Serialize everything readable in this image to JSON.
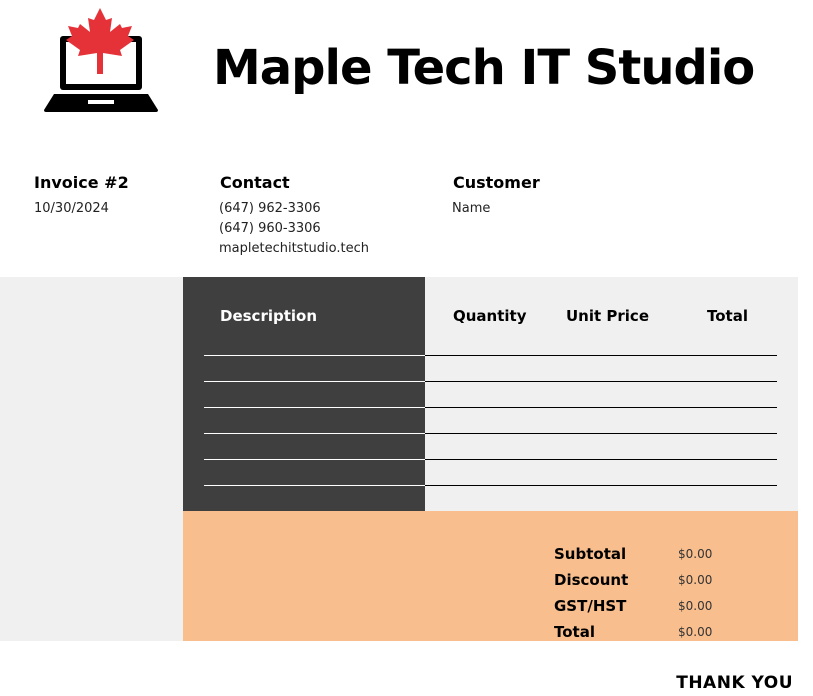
{
  "header": {
    "title": "Maple Tech IT Studio",
    "logo_icon": "laptop-maple-leaf-icon",
    "logo_colors": {
      "leaf": "#e53238",
      "laptop": "#000000"
    }
  },
  "invoice": {
    "label": "Invoice #2",
    "date": "10/30/2024"
  },
  "contact": {
    "label": "Contact",
    "phone1": "(647) 962-3306",
    "phone2": "(647) 960-3306",
    "website": "mapletechitstudio.tech"
  },
  "customer": {
    "label": "Customer",
    "name": "Name"
  },
  "table": {
    "headers": {
      "description": "Description",
      "quantity": "Quantity",
      "unit_price": "Unit Price",
      "total": "Total"
    },
    "rows": [
      {
        "description": "",
        "quantity": "",
        "unit_price": "",
        "total": ""
      },
      {
        "description": "",
        "quantity": "",
        "unit_price": "",
        "total": ""
      },
      {
        "description": "",
        "quantity": "",
        "unit_price": "",
        "total": ""
      },
      {
        "description": "",
        "quantity": "",
        "unit_price": "",
        "total": ""
      },
      {
        "description": "",
        "quantity": "",
        "unit_price": "",
        "total": ""
      },
      {
        "description": "",
        "quantity": "",
        "unit_price": "",
        "total": ""
      }
    ]
  },
  "summary": {
    "subtotal_label": "Subtotal",
    "subtotal": "$0.00",
    "discount_label": "Discount",
    "discount": "$0.00",
    "tax_label": "GST/HST",
    "tax": "$0.00",
    "total_label": "Total",
    "total": "$0.00"
  },
  "footer": {
    "thanks": "THANK YOU"
  },
  "colors": {
    "band": "#f1f0f0",
    "description_column": "#3f3f3f",
    "summary_band": "#f8be8e"
  }
}
